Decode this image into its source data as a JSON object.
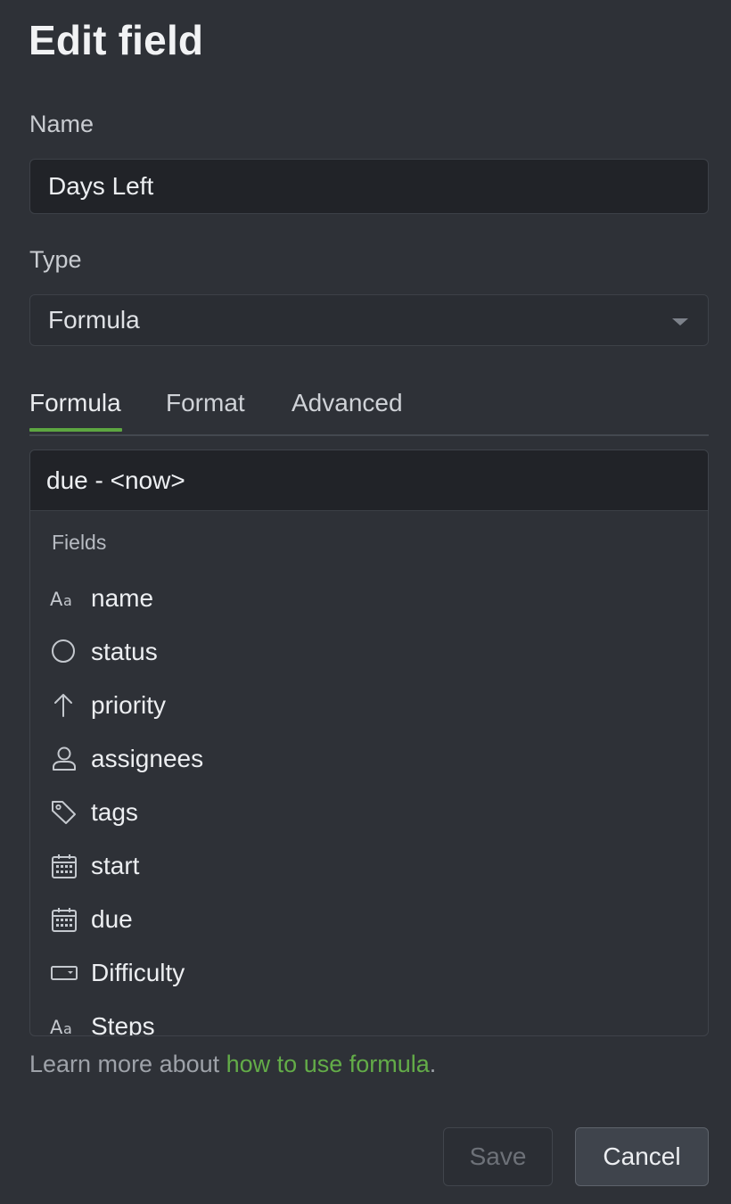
{
  "dialog": {
    "title": "Edit field"
  },
  "name_field": {
    "label": "Name",
    "value": "Days Left"
  },
  "type_field": {
    "label": "Type",
    "value": "Formula"
  },
  "tabs": [
    {
      "label": "Formula",
      "active": true
    },
    {
      "label": "Format",
      "active": false
    },
    {
      "label": "Advanced",
      "active": false
    }
  ],
  "formula": {
    "expression": "due - <now>",
    "fields_heading": "Fields",
    "fields": [
      {
        "label": "name",
        "icon": "text-icon"
      },
      {
        "label": "status",
        "icon": "circle-icon"
      },
      {
        "label": "priority",
        "icon": "arrow-up-icon"
      },
      {
        "label": "assignees",
        "icon": "person-icon"
      },
      {
        "label": "tags",
        "icon": "tag-icon"
      },
      {
        "label": "start",
        "icon": "calendar-icon"
      },
      {
        "label": "due",
        "icon": "calendar-icon"
      },
      {
        "label": "Difficulty",
        "icon": "dropdown-icon"
      },
      {
        "label": "Steps",
        "icon": "text-icon"
      }
    ]
  },
  "help": {
    "prefix": "Learn more about ",
    "link_text": "how to use formula",
    "suffix": "."
  },
  "actions": {
    "save_label": "Save",
    "cancel_label": "Cancel"
  },
  "colors": {
    "background": "#2e3137",
    "input_background": "#212328",
    "accent": "#5da641",
    "link": "#63ac48"
  }
}
